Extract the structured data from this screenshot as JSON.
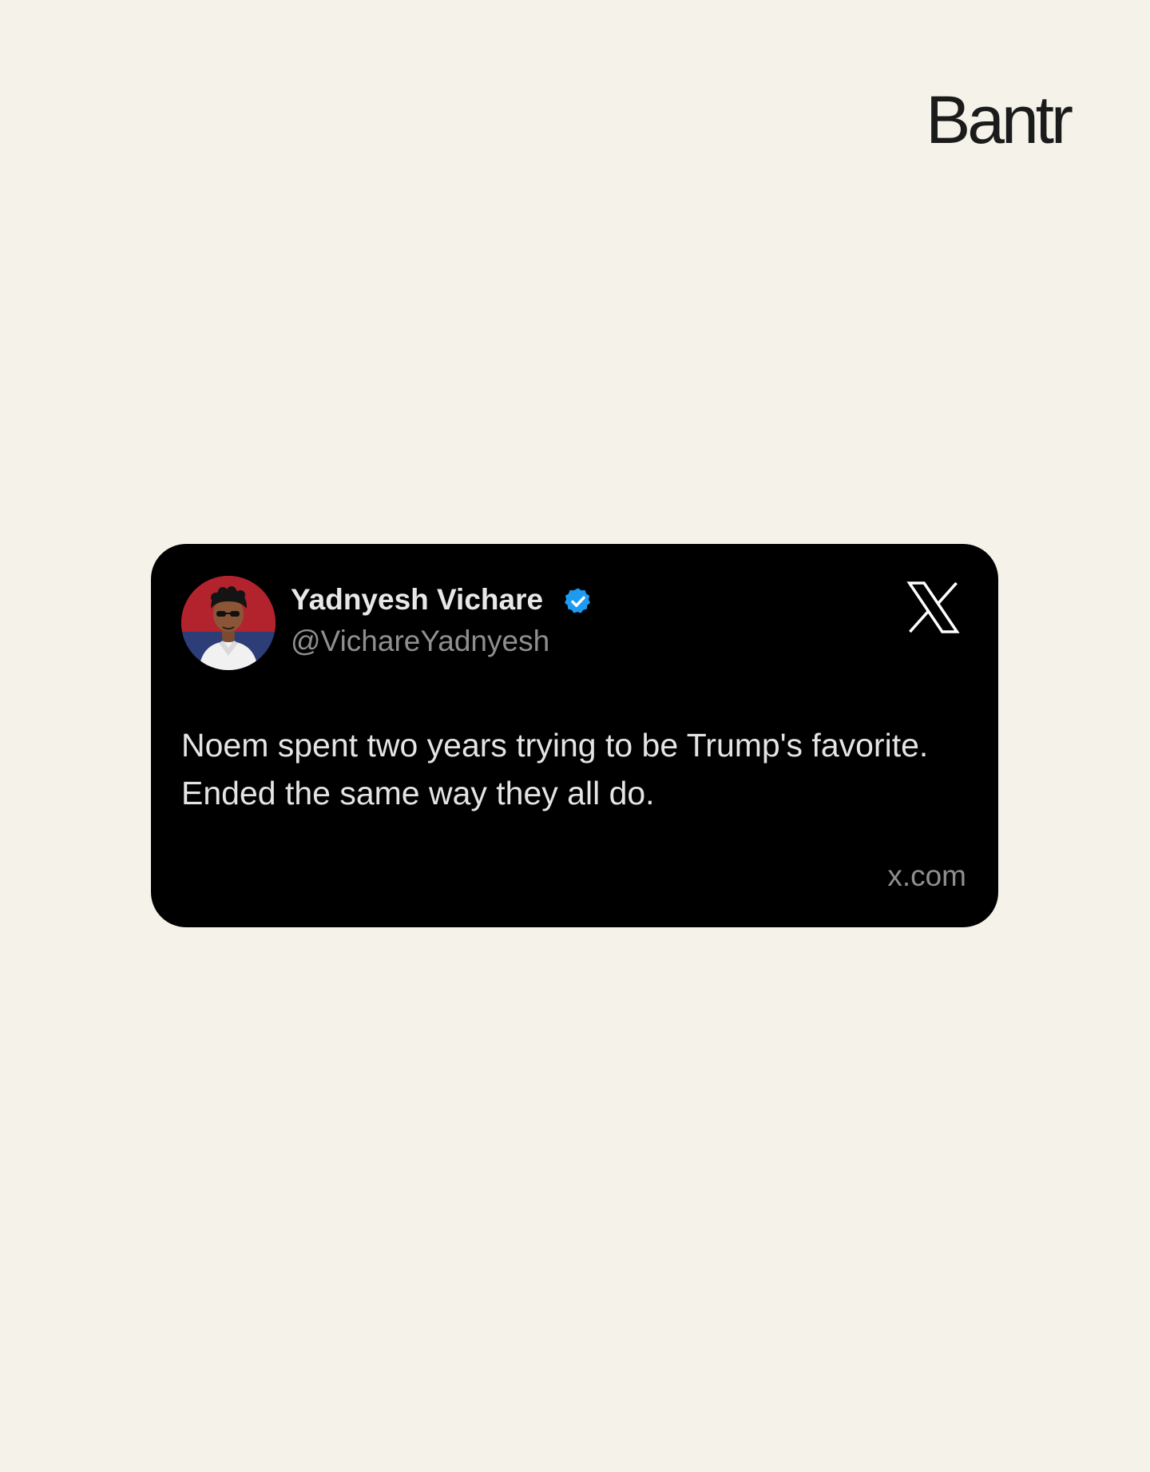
{
  "brand": {
    "name": "Bantr"
  },
  "tweet": {
    "author_name": "Yadnyesh Vichare",
    "author_handle": "@VichareYadnyesh",
    "verified": true,
    "text": "Noem spent two years trying to be Trump's favorite. Ended the same way they all do.",
    "source": "x.com",
    "platform_icon": "x-logo-icon",
    "avatar_icon": "avatar-photo",
    "verified_icon": "verified-badge-icon"
  },
  "colors": {
    "background": "#f5f3e9",
    "card": "#000000",
    "verified": "#1d9bf0",
    "text": "#e4e4e4",
    "secondary_text": "#8f8f8f",
    "brand_text": "#1b1b1b"
  }
}
